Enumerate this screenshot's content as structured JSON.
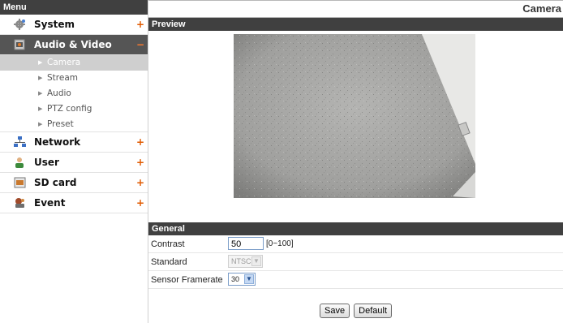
{
  "sidebar": {
    "header": "Menu",
    "items": [
      {
        "label": "System",
        "icon": "gear-icon",
        "expander": "+",
        "active": false
      },
      {
        "label": "Audio & Video",
        "icon": "camera-icon",
        "expander": "−",
        "active": true,
        "subitems": [
          {
            "label": "Camera",
            "active": true
          },
          {
            "label": "Stream",
            "active": false
          },
          {
            "label": "Audio",
            "active": false
          },
          {
            "label": "PTZ config",
            "active": false
          },
          {
            "label": "Preset",
            "active": false
          }
        ]
      },
      {
        "label": "Network",
        "icon": "network-icon",
        "expander": "+",
        "active": false
      },
      {
        "label": "User",
        "icon": "user-icon",
        "expander": "+",
        "active": false
      },
      {
        "label": "SD card",
        "icon": "sd-card-icon",
        "expander": "+",
        "active": false
      },
      {
        "label": "Event",
        "icon": "event-icon",
        "expander": "+",
        "active": false
      }
    ]
  },
  "page": {
    "title": "Camera"
  },
  "preview": {
    "title": "Preview"
  },
  "general": {
    "title": "General",
    "contrast": {
      "label": "Contrast",
      "value": "50",
      "range": "[0~100]"
    },
    "standard": {
      "label": "Standard",
      "value": "NTSC"
    },
    "sensor_framerate": {
      "label": "Sensor Framerate",
      "value": "30"
    }
  },
  "buttons": {
    "save": "Save",
    "default": "Default"
  },
  "colors": {
    "header_bar": "#404040",
    "active_item": "#555555",
    "active_subitem": "#cfcfcf",
    "expander": "#e05a00"
  }
}
